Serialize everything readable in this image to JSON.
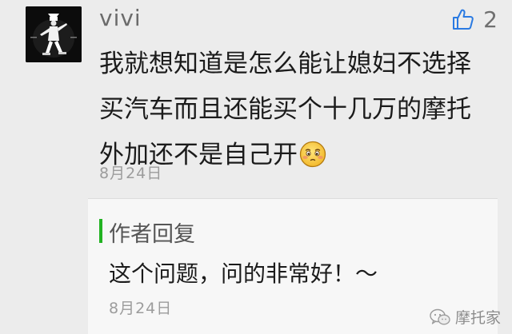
{
  "comment": {
    "username": "vivi",
    "likes": "2",
    "lines": [
      "我就想知道是怎么能让媳妇不选择",
      "买汽车而且还能买个十几万的摩托",
      "外加还不是自己开"
    ],
    "emoji": "blushing-face-emoji",
    "date": "8月24日"
  },
  "reply": {
    "label": "作者回复",
    "text": "这个问题，问的非常好！～",
    "date": "8月24日",
    "accent_color": "#22b322"
  },
  "watermark": {
    "text": "摩托家"
  }
}
